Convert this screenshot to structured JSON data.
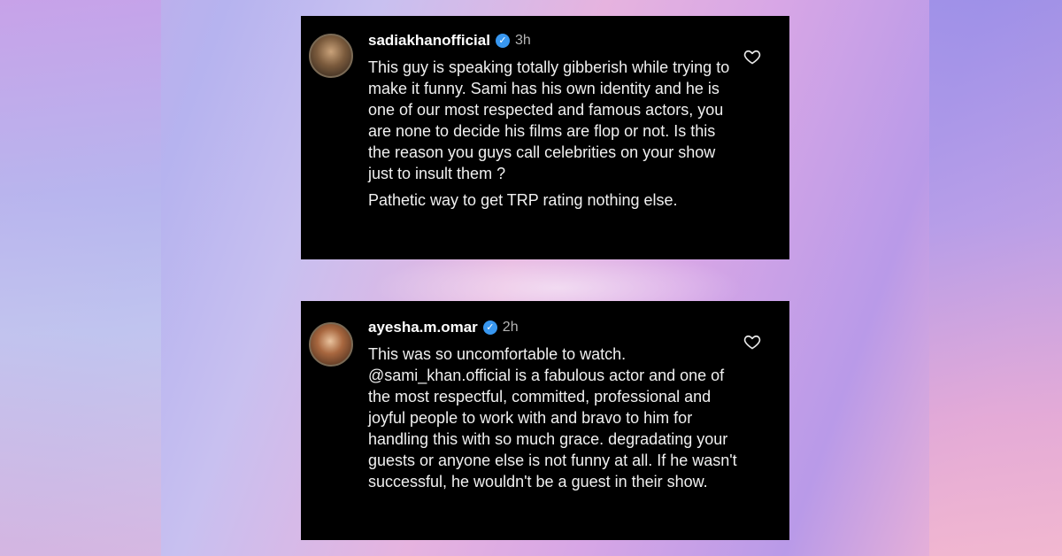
{
  "comments": [
    {
      "username": "sadiakhanofficial",
      "verified": true,
      "time": "3h",
      "paragraphs": [
        "This guy is speaking totally gibberish while trying to make it funny. Sami has his own identity and he is one of our most respected and famous actors, you are none to decide his films are flop or not. Is this the reason you guys call celebrities on your show just to insult them ?",
        "Pathetic way to get TRP rating nothing else."
      ],
      "like_icon": "heart-outline-icon"
    },
    {
      "username": "ayesha.m.omar",
      "verified": true,
      "time": "2h",
      "paragraphs": [
        "This was so uncomfortable to watch. @sami_khan.official is a fabulous actor and one of the most respectful, committed, professional and joyful people to work with and bravo to him for handling this with so much grace. degradating your guests or anyone else is not funny at all. If he wasn't successful, he wouldn't be a guest in their show."
      ],
      "like_icon": "heart-outline-icon"
    }
  ],
  "colors": {
    "card_bg": "#000000",
    "verified_badge": "#3897f0",
    "time_text": "#b5b5b5"
  }
}
